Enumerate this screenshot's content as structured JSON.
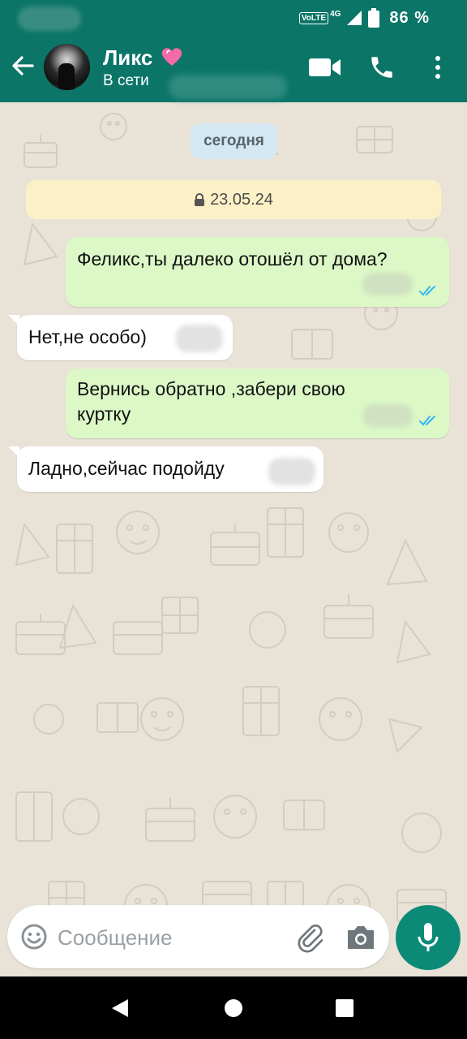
{
  "status_bar": {
    "volte": "VoLTE",
    "network": "4G",
    "battery": "86 %"
  },
  "header": {
    "contact_name": "Ликс",
    "contact_status": "В сети",
    "heart_icon": "pink-heart-emoji"
  },
  "chat": {
    "date_chip": "сегодня",
    "encryption_notice": "23.05.24",
    "messages": [
      {
        "direction": "out",
        "text": "Феликс,ты далеко отошёл от дома?",
        "status": "read"
      },
      {
        "direction": "in",
        "text": "Нет,не особо)"
      },
      {
        "direction": "out",
        "text_line1": "Вернись обратно ,забери свою",
        "text_line2": "куртку",
        "status": "read"
      },
      {
        "direction": "in",
        "text": "Ладно,сейчас подойду"
      }
    ]
  },
  "composer": {
    "placeholder": "Сообщение"
  },
  "colors": {
    "header_bg": "#0b7568",
    "outgoing_bubble": "#dcf8c6",
    "incoming_bubble": "#ffffff",
    "read_ticks": "#34b7f1",
    "mic_button": "#0b8a78"
  }
}
